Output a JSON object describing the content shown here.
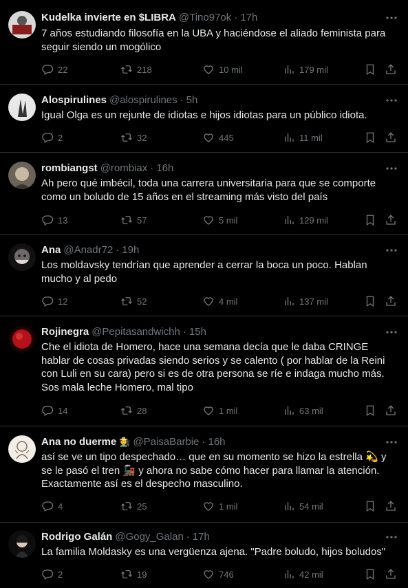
{
  "colors": {
    "background": "#000000",
    "text": "#e7e9ea",
    "muted": "#71767b",
    "border": "#2f3336"
  },
  "icons": [
    "reply-icon",
    "retweet-icon",
    "like-icon",
    "views-icon",
    "bookmark-icon",
    "share-icon",
    "more-icon"
  ],
  "tweets": [
    {
      "name": "Kudelka invierte en $LIBRA",
      "handle": "@Tino97ok",
      "sep": "·",
      "time": "17h",
      "badge": "",
      "text": "7 años estudiando filosofía en la UBA y haciéndose el aliado feminista para seguir siendo un mogólico",
      "replies": "22",
      "retweets": "218",
      "likes": "10 mil",
      "views": "179 mil"
    },
    {
      "name": "Alospirulines",
      "handle": "@alospirulines",
      "sep": "·",
      "time": "5h",
      "badge": "",
      "text": "Igual Olga es un rejunte de idiotas e hijos idiotas para un público idiota.",
      "replies": "2",
      "retweets": "32",
      "likes": "445",
      "views": "11 mil"
    },
    {
      "name": "rombiangst",
      "handle": "@rombiax",
      "sep": "·",
      "time": "16h",
      "badge": "",
      "text": "Ah pero qué imbécil, toda una carrera universitaria para que se comporte como un boludo de 15 años en el streaming más visto del país",
      "replies": "13",
      "retweets": "57",
      "likes": "5 mil",
      "views": "129 mil"
    },
    {
      "name": "Ana",
      "handle": "@Anadr72",
      "sep": "·",
      "time": "19h",
      "badge": "",
      "text": "Los moldavsky tendrían que aprender a cerrar la boca un poco. Hablan mucho y al pedo",
      "replies": "12",
      "retweets": "52",
      "likes": "4 mil",
      "views": "137 mil"
    },
    {
      "name": "Rojinegra",
      "handle": "@Pepitasandwichh",
      "sep": "·",
      "time": "15h",
      "badge": "",
      "text": "Che el idiota de Homero, hace una semana decía que le daba CRINGE hablar de cosas privadas siendo serios y se calento ( por hablar de la Reini con Luli en su cara) pero si es de otra persona se ríe e indaga mucho más. Sos mala leche Homero, mal tipo",
      "replies": "14",
      "retweets": "28",
      "likes": "1 mil",
      "views": "63 mil"
    },
    {
      "name": "Ana no duerme",
      "handle": "@PaisaBarbie",
      "sep": "·",
      "time": "16h",
      "badge": "🧑‍🌾",
      "text": "así se ve un tipo despechado… que en su momento se hizo la estrella 💫 y se le pasó el tren 🚂 y ahora no sabe cómo hacer para llamar la atención. Exactamente así es el despecho masculino.",
      "replies": "4",
      "retweets": "25",
      "likes": "1 mil",
      "views": "54 mil"
    },
    {
      "name": "Rodrigo Galán",
      "handle": "@Gogy_Galan",
      "sep": "·",
      "time": "17h",
      "badge": "",
      "text": "La familia Moldasky es una vergüenza ajena. \"Padre boludo, hijos boludos\"",
      "replies": "2",
      "retweets": "19",
      "likes": "746",
      "views": "42 mil"
    }
  ]
}
